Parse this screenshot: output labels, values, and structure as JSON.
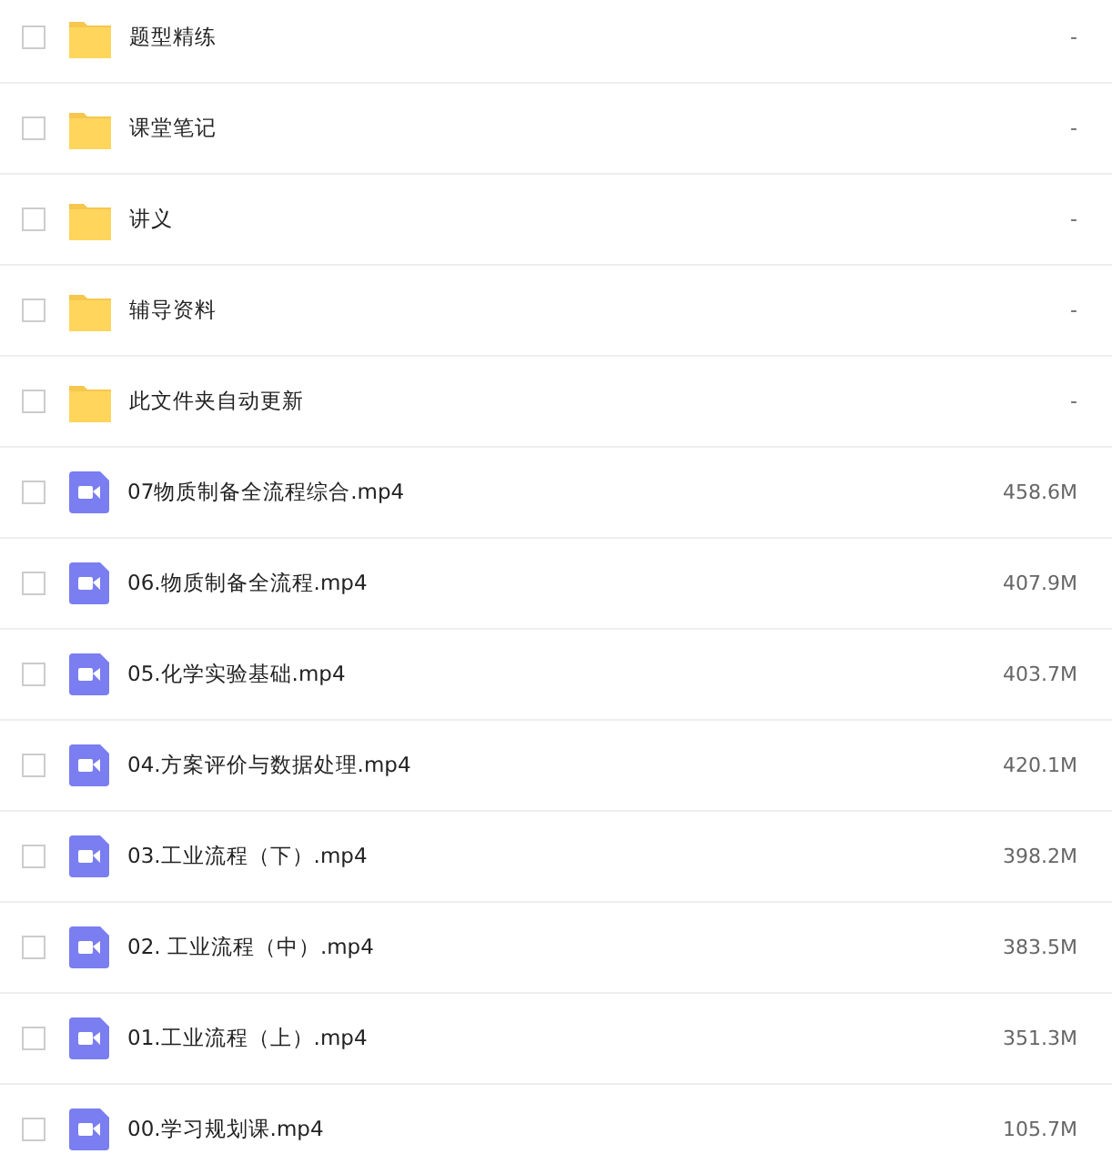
{
  "files": [
    {
      "kind": "folder",
      "name": "题型精练",
      "size": "-",
      "checked": false
    },
    {
      "kind": "folder",
      "name": "课堂笔记",
      "size": "-",
      "checked": false
    },
    {
      "kind": "folder",
      "name": "讲义",
      "size": "-",
      "checked": false
    },
    {
      "kind": "folder",
      "name": "辅导资料",
      "size": "-",
      "checked": false
    },
    {
      "kind": "folder",
      "name": "此文件夹自动更新",
      "size": "-",
      "checked": false
    },
    {
      "kind": "video",
      "name": "07物质制备全流程综合.mp4",
      "size": "458.6M",
      "checked": false
    },
    {
      "kind": "video",
      "name": "06.物质制备全流程.mp4",
      "size": "407.9M",
      "checked": false
    },
    {
      "kind": "video",
      "name": "05.化学实验基础.mp4",
      "size": "403.7M",
      "checked": false
    },
    {
      "kind": "video",
      "name": "04.方案评价与数据处理.mp4",
      "size": "420.1M",
      "checked": false
    },
    {
      "kind": "video",
      "name": "03.工业流程（下）.mp4",
      "size": "398.2M",
      "checked": false
    },
    {
      "kind": "video",
      "name": "02. 工业流程（中）.mp4",
      "size": "383.5M",
      "checked": false
    },
    {
      "kind": "video",
      "name": "01.工业流程（上）.mp4",
      "size": "351.3M",
      "checked": false
    },
    {
      "kind": "video",
      "name": "00.学习规划课.mp4",
      "size": "105.7M",
      "checked": false
    }
  ]
}
